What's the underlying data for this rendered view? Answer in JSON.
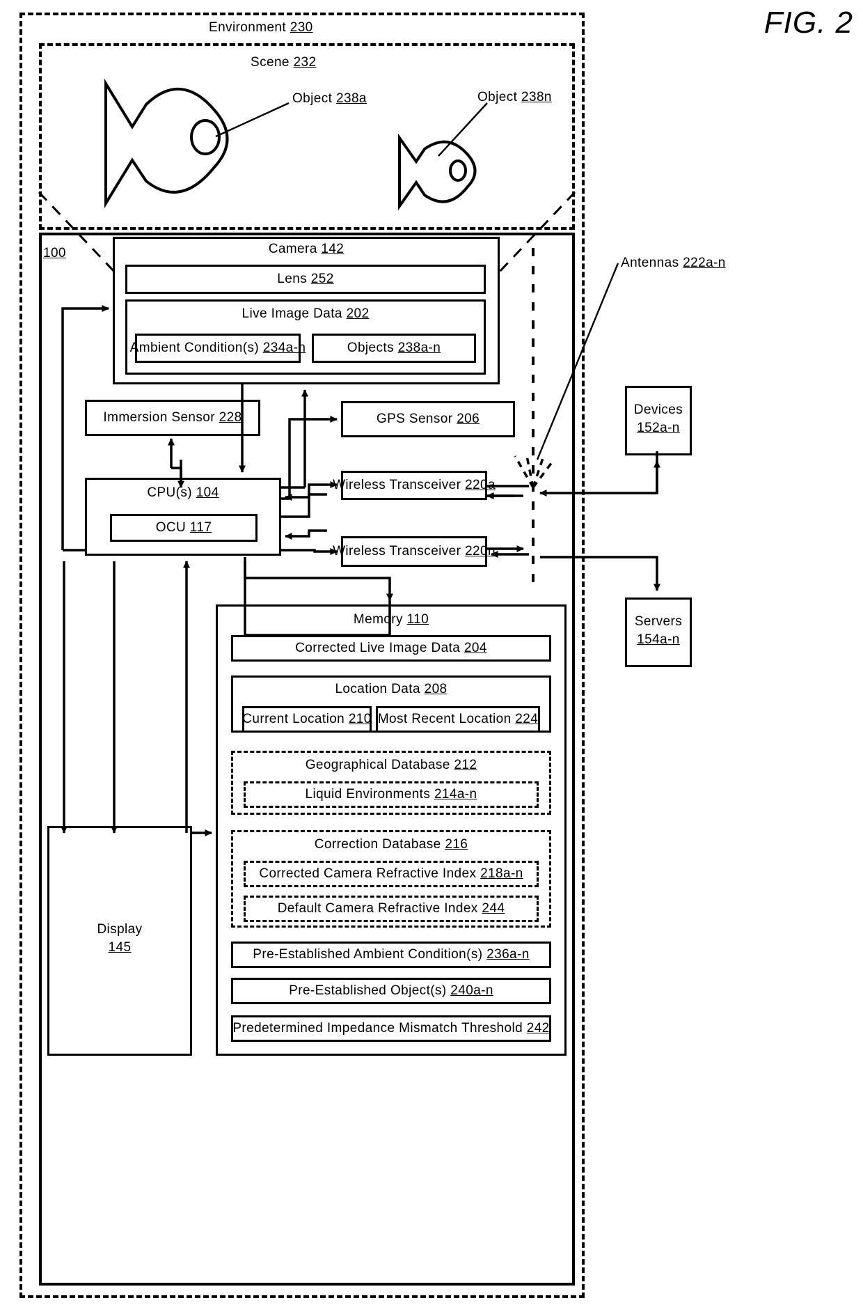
{
  "figure": {
    "title": "FIG. 2"
  },
  "environment": {
    "label": "Environment",
    "num": "230",
    "scene": {
      "label": "Scene",
      "num": "232"
    },
    "objects": [
      {
        "label": "Object",
        "num": "238a"
      },
      {
        "label": "Object",
        "num": "238n"
      }
    ]
  },
  "device": {
    "num": "100",
    "camera": {
      "label": "Camera",
      "num": "142",
      "lens": {
        "label": "Lens",
        "num": "252"
      },
      "live_image_data": {
        "label": "Live Image Data",
        "num": "202",
        "ambient_conditions": {
          "label": "Ambient Condition(s)",
          "num": "234a-n"
        },
        "objects": {
          "label": "Objects",
          "num": "238a-n"
        }
      }
    },
    "immersion_sensor": {
      "label": "Immersion Sensor",
      "num": "228"
    },
    "gps_sensor": {
      "label": "GPS Sensor",
      "num": "206"
    },
    "cpu": {
      "label": "CPU(s)",
      "num": "104",
      "ocu": {
        "label": "OCU",
        "num": "117"
      }
    },
    "wireless_transceiver_a": {
      "label": "Wireless Transceiver",
      "num": "220a"
    },
    "wireless_transceiver_n": {
      "label": "Wireless Transceiver",
      "num": "220n"
    },
    "display": {
      "label": "Display",
      "num": "145"
    },
    "memory": {
      "label": "Memory",
      "num": "110",
      "corrected_live_image_data": {
        "label": "Corrected Live Image Data",
        "num": "204"
      },
      "location_data": {
        "label": "Location Data",
        "num": "208",
        "current_location": {
          "label": "Current Location",
          "num": "210"
        },
        "most_recent_location": {
          "label": "Most Recent Location",
          "num": "224"
        }
      },
      "geographical_database": {
        "label": "Geographical Database",
        "num": "212",
        "liquid_environments": {
          "label": "Liquid Environments",
          "num": "214a-n"
        }
      },
      "correction_database": {
        "label": "Correction Database",
        "num": "216",
        "corrected_camera_refractive_index": {
          "label": "Corrected Camera Refractive Index",
          "num": "218a-n"
        },
        "default_camera_refractive_index": {
          "label": "Default Camera Refractive Index",
          "num": "244"
        }
      },
      "pre_established_ambient_conditions": {
        "label": "Pre-Established Ambient Condition(s)",
        "num": "236a-n"
      },
      "pre_established_objects": {
        "label": "Pre-Established Object(s)",
        "num": "240a-n"
      },
      "predetermined_impedance_mismatch_threshold": {
        "label": "Predetermined Impedance Mismatch Threshold",
        "num": "242"
      }
    }
  },
  "antennas": {
    "label": "Antennas",
    "num": "222a-n"
  },
  "external": {
    "devices": {
      "label": "Devices",
      "num": "152a-n"
    },
    "servers": {
      "label": "Servers",
      "num": "154a-n"
    }
  },
  "colors": {
    "ink": "#000000",
    "paper": "#ffffff"
  }
}
